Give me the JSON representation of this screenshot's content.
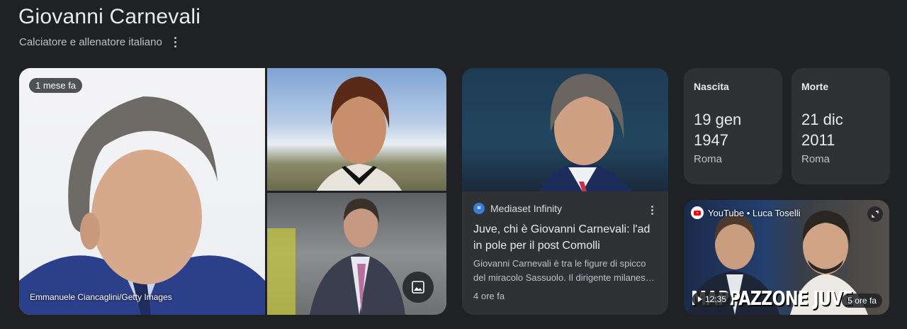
{
  "header": {
    "title": "Giovanni Carnevali",
    "subtitle": "Calciatore e allenatore italiano"
  },
  "images": {
    "main": {
      "time_badge": "1 mese fa",
      "credit": "Emmanuele Ciancaglini/Getty Images"
    }
  },
  "article": {
    "source": "Mediaset Infinity",
    "title": "Juve, chi è Giovanni Carnevali: l'ad in pole per il post Comolli",
    "snippet_line1": "Giovanni Carnevali è tra le figure di spicco",
    "snippet_line2": "del miracolo Sassuolo. Il dirigente milanese...",
    "time": "4 ore fa"
  },
  "birth": {
    "label": "Nascita",
    "date_line1": "19 gen",
    "date_line2": "1947",
    "place": "Roma"
  },
  "death": {
    "label": "Morte",
    "date_line1": "21 dic",
    "date_line2": "2011",
    "place": "Roma"
  },
  "video": {
    "source": "YouTube • Luca Toselli",
    "banner": "MAPPAZZONE JUVE",
    "duration": "12:35",
    "time": "5 ore fa"
  }
}
